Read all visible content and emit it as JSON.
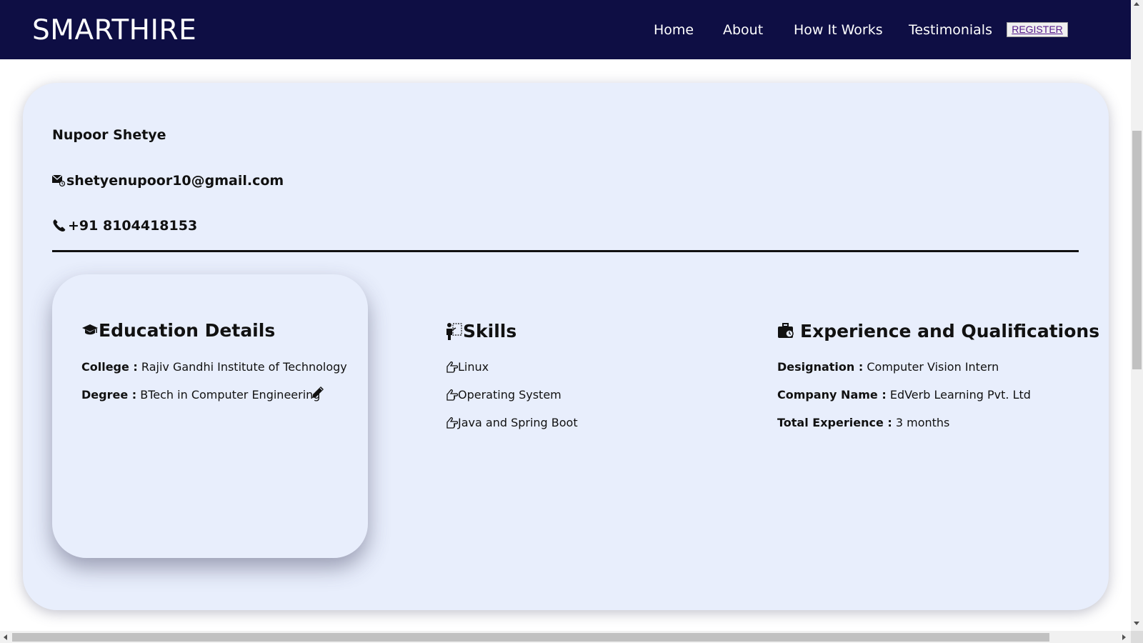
{
  "header": {
    "brand": "SMARTHIRE",
    "nav": [
      "Home",
      "About",
      "How It Works",
      "Testimonials"
    ],
    "register_label": "REGISTER"
  },
  "profile": {
    "name": "Nupoor Shetye",
    "email": "shetyenupoor10@gmail.com",
    "phone": "+91 8104418153"
  },
  "education": {
    "title": "Education Details",
    "college_label": "College :",
    "college_value": "Rajiv Gandhi Institute of Technology",
    "degree_label": "Degree :",
    "degree_value": "BTech in Computer Engineering"
  },
  "skills": {
    "title": "Skills",
    "items": [
      "Linux",
      "Operating System",
      "Java and Spring Boot"
    ]
  },
  "experience": {
    "title": "Experience and Qualifications",
    "designation_label": "Designation :",
    "designation_value": "Computer Vision Intern",
    "company_label": "Company Name :",
    "company_value": "EdVerb Learning Pvt. Ltd",
    "total_label": "Total Experience :",
    "total_value": "3 months"
  },
  "icons": {
    "email": "email-icon",
    "phone": "phone-icon",
    "education": "graduation-cap-icon",
    "skills": "teacher-board-icon",
    "experience": "briefcase-clock-icon",
    "skill_bullet": "hand-pointing-icon",
    "edit": "pencil-icon"
  },
  "colors": {
    "navbar": "#0e0e44",
    "card": "#e8eefc",
    "register_text": "#551a8b"
  }
}
